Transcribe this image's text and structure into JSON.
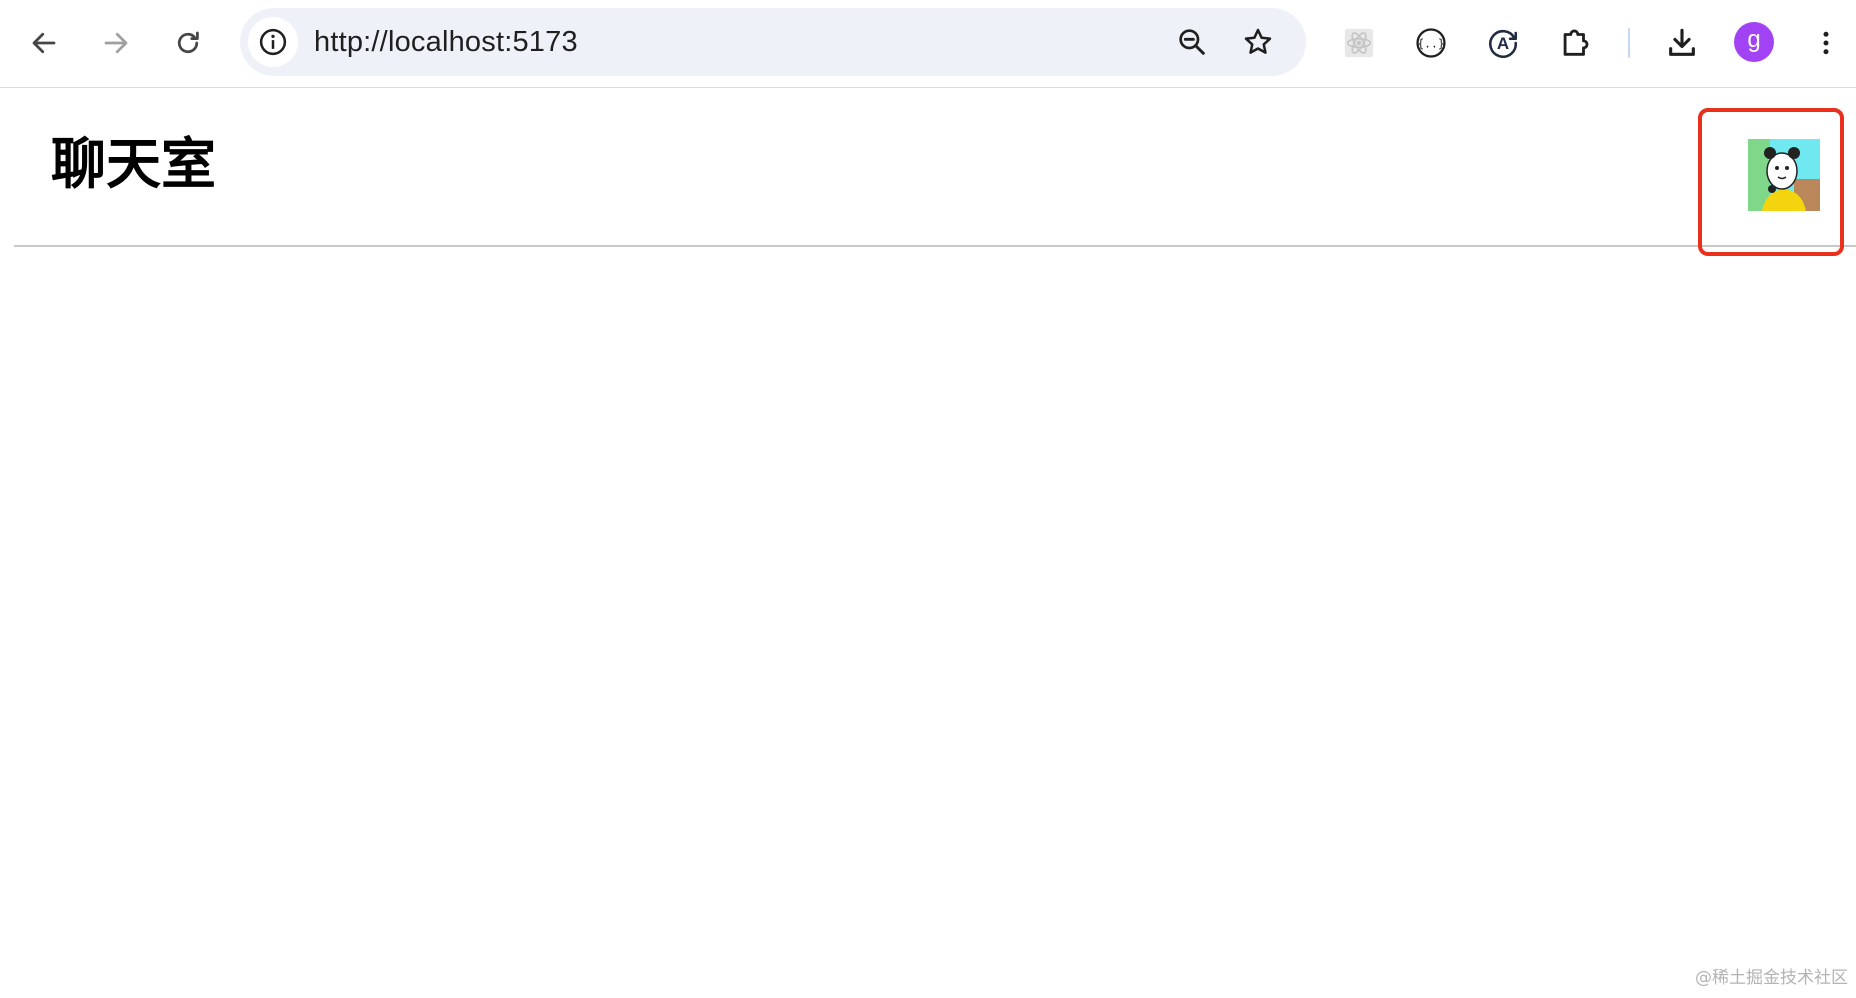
{
  "browser": {
    "url": "http://localhost:5173",
    "profile_initial": "g",
    "profile_color": "#a142f4",
    "icons": {
      "back": "arrow-left-icon",
      "forward": "arrow-right-icon",
      "reload": "reload-icon",
      "site_info": "info-icon",
      "zoom": "zoom-out-icon",
      "bookmark": "star-icon",
      "ext_react": "react-devtools-icon",
      "ext_json": "json-braces-icon",
      "ext_translate": "translate-a-icon",
      "extensions": "puzzle-icon",
      "downloads": "download-icon",
      "menu": "kebab-menu-icon"
    }
  },
  "page": {
    "title": "聊天室",
    "user_avatar": "cartoon-avatar-image",
    "highlight_color": "#e8301c"
  },
  "watermark": "@稀土掘金技术社区"
}
